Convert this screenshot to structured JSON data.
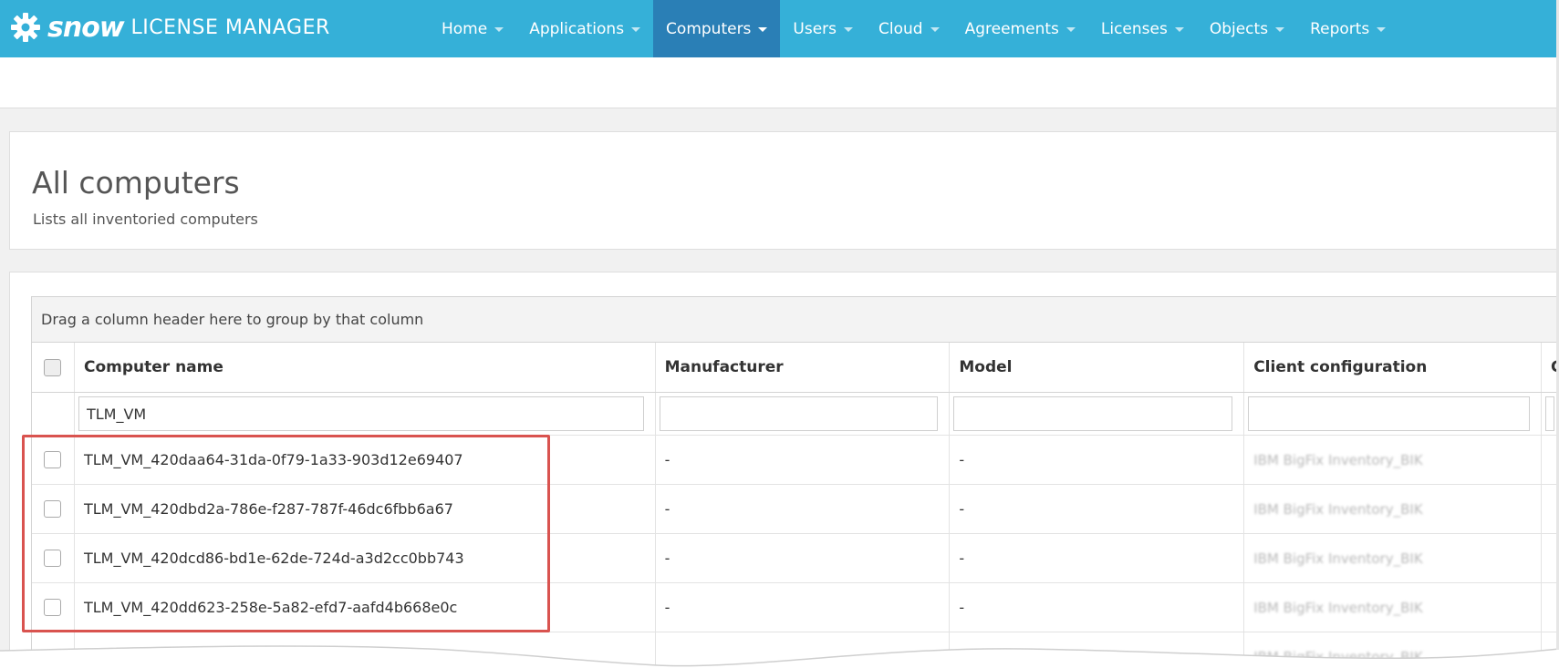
{
  "brand": {
    "wordmark": "snow",
    "product": "LICENSE MANAGER"
  },
  "nav": [
    {
      "label": "Home",
      "active": false
    },
    {
      "label": "Applications",
      "active": false
    },
    {
      "label": "Computers",
      "active": true
    },
    {
      "label": "Users",
      "active": false
    },
    {
      "label": "Cloud",
      "active": false
    },
    {
      "label": "Agreements",
      "active": false
    },
    {
      "label": "Licenses",
      "active": false
    },
    {
      "label": "Objects",
      "active": false
    },
    {
      "label": "Reports",
      "active": false
    }
  ],
  "page": {
    "title": "All computers",
    "subtitle": "Lists all inventoried computers"
  },
  "grid": {
    "group_hint": "Drag a column header here to group by that column",
    "columns": [
      "Computer name",
      "Manufacturer",
      "Model",
      "Client configuration",
      "C"
    ],
    "filter": {
      "computer_name": "TLM_VM"
    },
    "rows": [
      {
        "name": "TLM_VM_420daa64-31da-0f79-1a33-903d12e69407",
        "manufacturer": "-",
        "model": "-",
        "client_config": "IBM BigFix Inventory_BIK"
      },
      {
        "name": "TLM_VM_420dbd2a-786e-f287-787f-46dc6fbb6a67",
        "manufacturer": "-",
        "model": "-",
        "client_config": "IBM BigFix Inventory_BIK"
      },
      {
        "name": "TLM_VM_420dcd86-bd1e-62de-724d-a3d2cc0bb743",
        "manufacturer": "-",
        "model": "-",
        "client_config": "IBM BigFix Inventory_BIK"
      },
      {
        "name": "TLM_VM_420dd623-258e-5a82-efd7-aafd4b668e0c",
        "manufacturer": "-",
        "model": "-",
        "client_config": "IBM BigFix Inventory_BIK"
      },
      {
        "name": "",
        "manufacturer": "",
        "model": "-",
        "client_config": "IBM BigFix Inventory_BIK"
      }
    ]
  },
  "colors": {
    "navbar": "#35b0d8",
    "nav_active": "#2a7fb6",
    "highlight": "#d9534f"
  }
}
